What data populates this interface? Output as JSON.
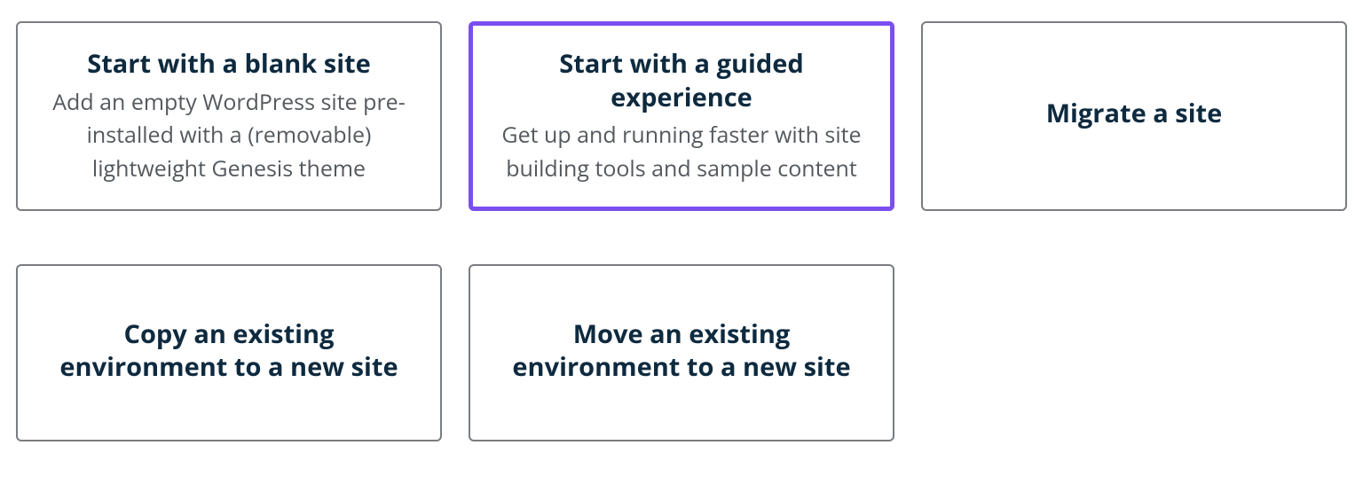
{
  "colors": {
    "border_default": "#7a7d80",
    "border_selected": "#7a4ff0",
    "title_text": "#0e2a3f",
    "desc_text": "#54595e"
  },
  "cards": [
    {
      "title": "Start with a blank site",
      "description": "Add an empty WordPress site pre-installed with a (removable) lightweight Genesis theme",
      "selected": false
    },
    {
      "title": "Start with a guided experience",
      "description": "Get up and running faster with site building tools and sample content",
      "selected": true
    },
    {
      "title": "Migrate a site",
      "description": "",
      "selected": false
    },
    {
      "title": "Copy an existing environment to a new site",
      "description": "",
      "selected": false
    },
    {
      "title": "Move an existing environment to a new site",
      "description": "",
      "selected": false
    }
  ]
}
